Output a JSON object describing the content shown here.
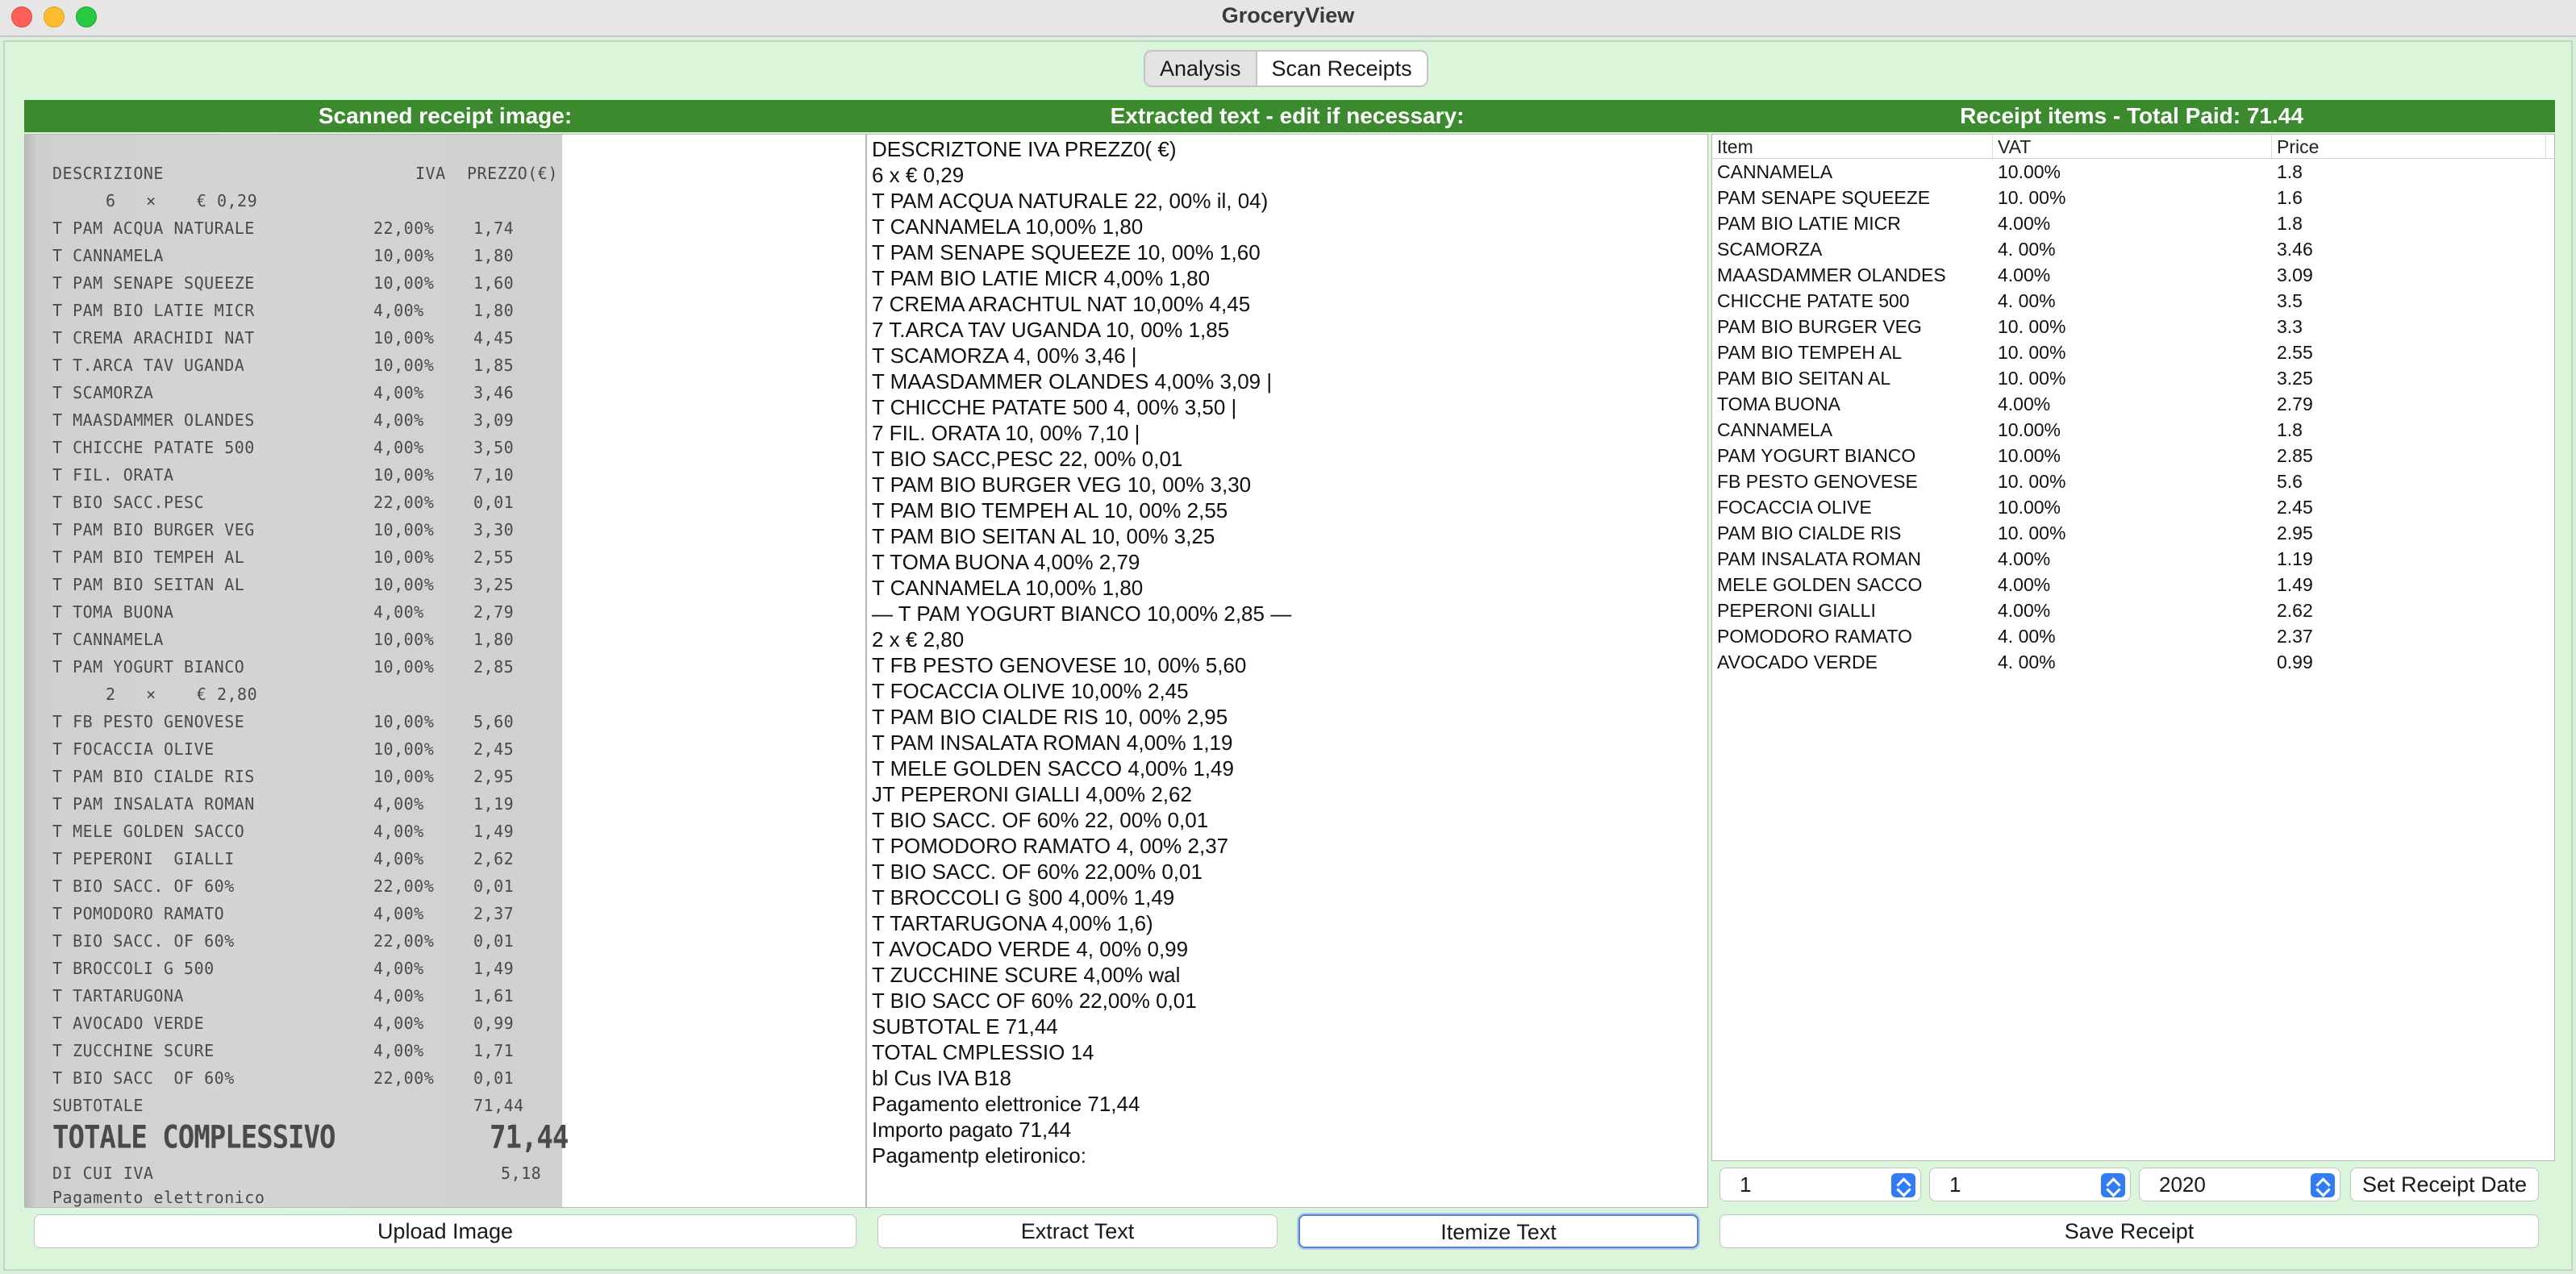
{
  "window": {
    "title": "GroceryView"
  },
  "tabs": [
    {
      "label": "Analysis",
      "active": false
    },
    {
      "label": "Scan Receipts",
      "active": true
    }
  ],
  "headers": {
    "image": "Scanned receipt image:",
    "text": "Extracted text - edit if necessary:",
    "items": "Receipt items - Total Paid: 71.44"
  },
  "receipt_image": {
    "header": {
      "desc": "DESCRIZIONE",
      "iva": "IVA",
      "price": "PREZZO(€)"
    },
    "lines": [
      {
        "desc": "6   ×    € 0,29",
        "iva": "",
        "price": "",
        "qty": true
      },
      {
        "desc": "T PAM ACQUA NATURALE",
        "iva": "22,00%",
        "price": "1,74"
      },
      {
        "desc": "T CANNAMELA",
        "iva": "10,00%",
        "price": "1,80"
      },
      {
        "desc": "T PAM SENAPE SQUEEZE",
        "iva": "10,00%",
        "price": "1,60"
      },
      {
        "desc": "T PAM BIO LATIE MICR",
        "iva": "4,00%",
        "price": "1,80"
      },
      {
        "desc": "T CREMA ARACHIDI NAT",
        "iva": "10,00%",
        "price": "4,45"
      },
      {
        "desc": "T T.ARCA TAV UGANDA",
        "iva": "10,00%",
        "price": "1,85"
      },
      {
        "desc": "T SCAMORZA",
        "iva": "4,00%",
        "price": "3,46"
      },
      {
        "desc": "T MAASDAMMER OLANDES",
        "iva": "4,00%",
        "price": "3,09"
      },
      {
        "desc": "T CHICCHE PATATE 500",
        "iva": "4,00%",
        "price": "3,50"
      },
      {
        "desc": "T FIL. ORATA",
        "iva": "10,00%",
        "price": "7,10"
      },
      {
        "desc": "T BIO SACC.PESC",
        "iva": "22,00%",
        "price": "0,01"
      },
      {
        "desc": "T PAM BIO BURGER VEG",
        "iva": "10,00%",
        "price": "3,30"
      },
      {
        "desc": "T PAM BIO TEMPEH AL",
        "iva": "10,00%",
        "price": "2,55"
      },
      {
        "desc": "T PAM BIO SEITAN AL",
        "iva": "10,00%",
        "price": "3,25"
      },
      {
        "desc": "T TOMA BUONA",
        "iva": "4,00%",
        "price": "2,79"
      },
      {
        "desc": "T CANNAMELA",
        "iva": "10,00%",
        "price": "1,80"
      },
      {
        "desc": "T PAM YOGURT BIANCO",
        "iva": "10,00%",
        "price": "2,85"
      },
      {
        "desc": "2   ×    € 2,80",
        "iva": "",
        "price": "",
        "qty": true
      },
      {
        "desc": "T FB PESTO GENOVESE",
        "iva": "10,00%",
        "price": "5,60"
      },
      {
        "desc": "T FOCACCIA OLIVE",
        "iva": "10,00%",
        "price": "2,45"
      },
      {
        "desc": "T PAM BIO CIALDE RIS",
        "iva": "10,00%",
        "price": "2,95"
      },
      {
        "desc": "T PAM INSALATA ROMAN",
        "iva": "4,00%",
        "price": "1,19"
      },
      {
        "desc": "T MELE GOLDEN SACCO",
        "iva": "4,00%",
        "price": "1,49"
      },
      {
        "desc": "T PEPERONI  GIALLI",
        "iva": "4,00%",
        "price": "2,62"
      },
      {
        "desc": "T BIO SACC. OF 60%",
        "iva": "22,00%",
        "price": "0,01"
      },
      {
        "desc": "T POMODORO RAMATO",
        "iva": "4,00%",
        "price": "2,37"
      },
      {
        "desc": "T BIO SACC. OF 60%",
        "iva": "22,00%",
        "price": "0,01"
      },
      {
        "desc": "T BROCCOLI G 500",
        "iva": "4,00%",
        "price": "1,49"
      },
      {
        "desc": "T TARTARUGONA",
        "iva": "4,00%",
        "price": "1,61"
      },
      {
        "desc": "T AVOCADO VERDE",
        "iva": "4,00%",
        "price": "0,99"
      },
      {
        "desc": "T ZUCCHINE SCURE",
        "iva": "4,00%",
        "price": "1,71"
      },
      {
        "desc": "T BIO SACC  OF 60%",
        "iva": "22,00%",
        "price": "0,01"
      },
      {
        "desc": "SUBTOTALE",
        "iva": "",
        "price": "71,44"
      }
    ],
    "total_label": "TOTALE COMPLESSIVO",
    "total_value": "71,44",
    "dicui_label": "DI CUI IVA",
    "dicui_value": "5,18",
    "payment_label": "Pagamento elettronico"
  },
  "extracted_text": [
    "DESCRIZTONE IVA PREZZ0( €)",
    "6 x € 0,29",
    "T PAM ACQUA NATURALE 22, 00% il, 04)",
    "T CANNAMELA 10,00% 1,80",
    "T PAM SENAPE SQUEEZE 10, 00% 1,60",
    "T PAM BIO LATIE MICR 4,00% 1,80",
    "7 CREMA ARACHTUL NAT 10,00% 4,45",
    "7 T.ARCA TAV UGANDA 10, 00% 1,85",
    "T SCAMORZA 4, 00% 3,46 |",
    "T MAASDAMMER OLANDES 4,00% 3,09 |",
    "T CHICCHE PATATE 500 4, 00% 3,50 |",
    "7 FIL. ORATA 10, 00% 7,10 |",
    "T BIO SACC,PESC 22, 00% 0,01",
    "T PAM BIO BURGER VEG 10, 00% 3,30",
    "T PAM BIO TEMPEH AL 10, 00% 2,55",
    "T PAM BIO SEITAN AL 10, 00% 3,25",
    "T TOMA BUONA 4,00% 2,79",
    "T CANNAMELA 10,00% 1,80",
    "— T PAM YOGURT BIANCO 10,00% 2,85 —",
    "2 x € 2,80",
    "T FB PESTO GENOVESE 10, 00% 5,60",
    "T FOCACCIA OLIVE 10,00% 2,45",
    "T PAM BIO CIALDE RIS 10, 00% 2,95",
    "T PAM INSALATA ROMAN 4,00% 1,19",
    "T MELE GOLDEN SACCO 4,00% 1,49",
    "JT PEPERONI GIALLI 4,00% 2,62",
    "T BIO SACC. OF 60% 22, 00% 0,01",
    "T POMODORO RAMATO 4, 00% 2,37",
    "T BIO SACC. OF 60% 22,00% 0,01",
    "T BROCCOLI G §00 4,00% 1,49",
    "T TARTARUGONA 4,00% 1,6)",
    "T AVOCADO VERDE 4, 00% 0,99",
    "T ZUCCHINE SCURE 4,00% wal",
    "T BIO SACC OF 60% 22,00% 0,01",
    "SUBTOTAL E 71,44",
    "TOTAL CMPLESSIO 14",
    "bl Cus IVA B18",
    "Pagamento elettronice 71,44",
    "Importo pagato 71,44",
    "Pagamentp eletironico:"
  ],
  "items_table": {
    "columns": [
      "Item",
      "VAT",
      "Price"
    ],
    "rows": [
      [
        "CANNAMELA",
        "10.00%",
        "1.8"
      ],
      [
        "PAM SENAPE SQUEEZE",
        "10. 00%",
        "1.6"
      ],
      [
        "PAM BIO LATIE MICR",
        "4.00%",
        "1.8"
      ],
      [
        "SCAMORZA",
        "4. 00%",
        "3.46"
      ],
      [
        "MAASDAMMER OLANDES",
        "4.00%",
        "3.09"
      ],
      [
        "CHICCHE PATATE 500",
        "4. 00%",
        "3.5"
      ],
      [
        "PAM BIO BURGER VEG",
        "10. 00%",
        "3.3"
      ],
      [
        "PAM BIO TEMPEH AL",
        "10. 00%",
        "2.55"
      ],
      [
        "PAM BIO SEITAN AL",
        "10. 00%",
        "3.25"
      ],
      [
        "TOMA BUONA",
        "4.00%",
        "2.79"
      ],
      [
        "CANNAMELA",
        "10.00%",
        "1.8"
      ],
      [
        "PAM YOGURT BIANCO",
        "10.00%",
        "2.85"
      ],
      [
        "FB PESTO GENOVESE",
        "10. 00%",
        "5.6"
      ],
      [
        "FOCACCIA OLIVE",
        "10.00%",
        "2.45"
      ],
      [
        "PAM BIO CIALDE RIS",
        "10. 00%",
        "2.95"
      ],
      [
        "PAM INSALATA ROMAN",
        "4.00%",
        "1.19"
      ],
      [
        "MELE GOLDEN SACCO",
        "4.00%",
        "1.49"
      ],
      [
        "PEPERONI GIALLI",
        "4.00%",
        "2.62"
      ],
      [
        "POMODORO RAMATO",
        "4. 00%",
        "2.37"
      ],
      [
        "AVOCADO VERDE",
        "4. 00%",
        "0.99"
      ]
    ]
  },
  "date": {
    "day": "1",
    "month": "1",
    "year": "2020",
    "set_label": "Set Receipt Date"
  },
  "buttons": {
    "upload": "Upload Image",
    "extract": "Extract Text",
    "itemize": "Itemize Text",
    "save": "Save Receipt"
  }
}
